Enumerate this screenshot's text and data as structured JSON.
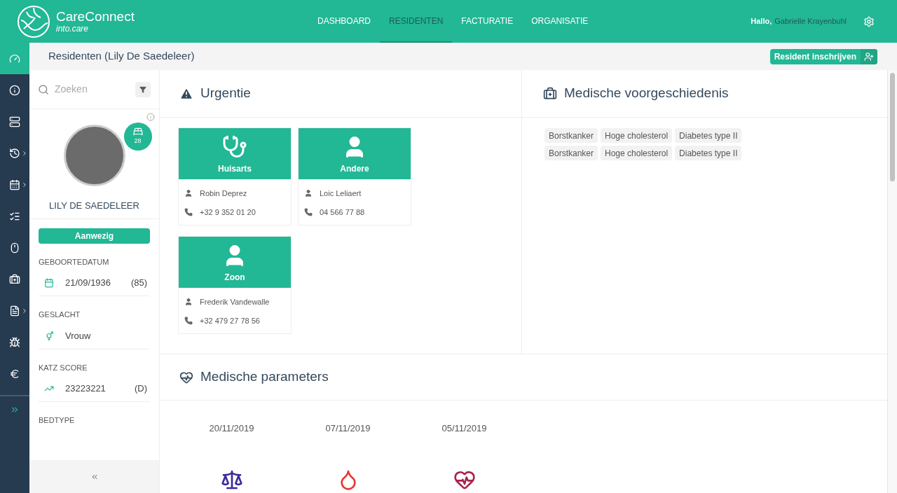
{
  "brand": {
    "name": "CareConnect",
    "tagline": "into.care"
  },
  "nav": [
    {
      "label": "DASHBOARD",
      "selected": false
    },
    {
      "label": "RESIDENTEN",
      "selected": true
    },
    {
      "label": "FACTURATIE",
      "selected": false
    },
    {
      "label": "ORGANISATIE",
      "selected": false
    }
  ],
  "user": {
    "greeting": "Hallo,",
    "name": "Gabrielle Krayenbuhl"
  },
  "side_nav": [
    {
      "kind": "dashboard",
      "selected": true,
      "submenu": false
    },
    {
      "kind": "info",
      "selected": false,
      "submenu": false
    },
    {
      "kind": "list",
      "selected": false,
      "submenu": false
    },
    {
      "kind": "history",
      "selected": false,
      "submenu": true
    },
    {
      "kind": "calendar",
      "selected": false,
      "submenu": true
    },
    {
      "kind": "checklist",
      "selected": false,
      "submenu": false
    },
    {
      "kind": "mouse",
      "selected": false,
      "submenu": false
    },
    {
      "kind": "medkit",
      "selected": false,
      "submenu": false
    },
    {
      "kind": "file",
      "selected": false,
      "submenu": true
    },
    {
      "kind": "bug",
      "selected": false,
      "submenu": false
    },
    {
      "kind": "euro",
      "selected": false,
      "submenu": false
    }
  ],
  "page_title": "Residenten (Lily De Saedeleer)",
  "register_button": "Resident inschrijven",
  "search": {
    "placeholder": "Zoeken"
  },
  "resident": {
    "name": "LILY DE SAEDELEER",
    "room": "28",
    "status": "Aanwezig",
    "fields": [
      {
        "kind": "date",
        "label": "GEBOORTEDATUM",
        "value": "21/09/1936",
        "extra": "(85)"
      },
      {
        "kind": "gender",
        "label": "GESLACHT",
        "value": "Vrouw"
      },
      {
        "kind": "score",
        "label": "KATZ SCORE",
        "value": "23223221",
        "extra": "(D)"
      },
      {
        "kind": "bed",
        "label": "BEDTYPE"
      }
    ]
  },
  "urgency": {
    "title": "Urgentie",
    "contacts": [
      {
        "kind": "doctor",
        "role": "Huisarts",
        "name": "Robin Deprez",
        "phone": "+32 9 352 01 20"
      },
      {
        "kind": "person",
        "role": "Andere",
        "name": "Loic Leliaert",
        "phone": "04 566 77 88"
      },
      {
        "kind": "person",
        "role": "Zoon",
        "name": "Frederik Vandewalle",
        "phone": "+32 479 27 78 56"
      }
    ]
  },
  "history": {
    "title": "Medische voorgeschiedenis",
    "tags": [
      "Borstkanker",
      "Hoge cholesterol",
      "Diabetes type II",
      "Borstkanker",
      "Hoge cholesterol",
      "Diabetes type II"
    ]
  },
  "parameters": {
    "title": "Medische parameters",
    "items": [
      {
        "kind": "weight",
        "date": "20/11/2019",
        "color": "#3d2a9b"
      },
      {
        "kind": "blood",
        "date": "07/11/2019",
        "color": "#e53935"
      },
      {
        "kind": "heart",
        "date": "05/11/2019",
        "color": "#a8234a"
      }
    ]
  }
}
